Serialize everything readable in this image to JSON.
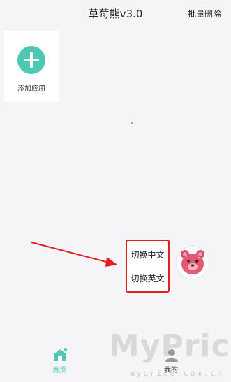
{
  "header": {
    "title": "草莓熊v3.0",
    "batch_delete": "批量删除"
  },
  "apps": {
    "add_label": "添加应用",
    "add_icon": "plus-icon"
  },
  "language_menu": {
    "items": [
      "切换中文",
      "切换英文"
    ],
    "highlight_color": "#e02020"
  },
  "tabbar": {
    "home": "首页",
    "mine": "我的",
    "active_color": "#4cc9b0"
  },
  "watermark": {
    "brand": "MyPrice",
    "domain": "myprice.com.cn"
  },
  "colors": {
    "accent": "#4cc9b0",
    "annotation_red": "#e02020"
  }
}
